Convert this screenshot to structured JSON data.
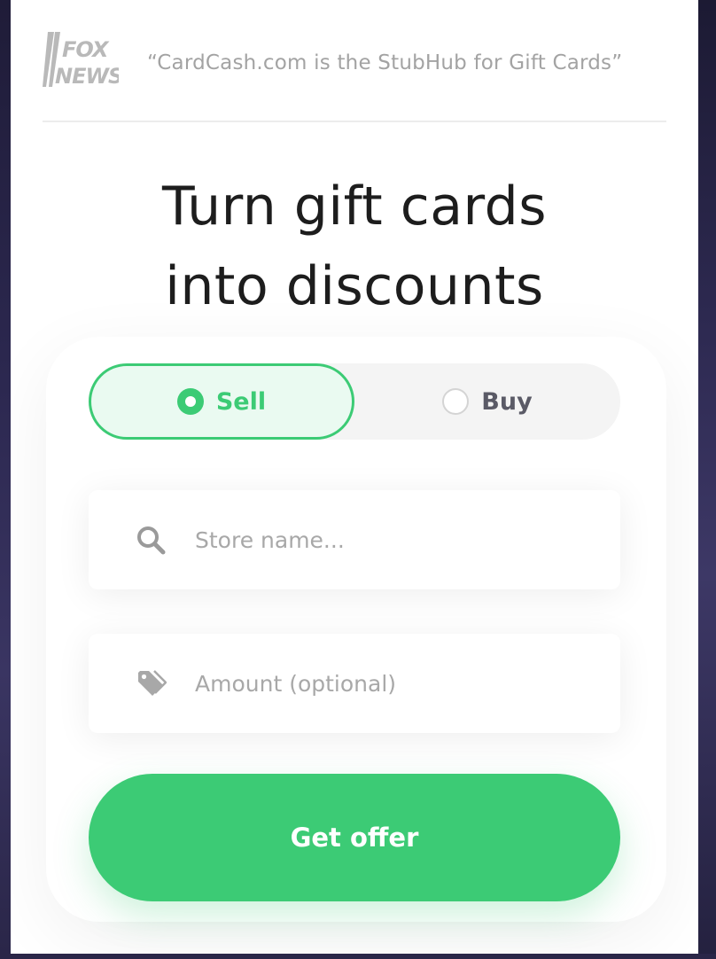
{
  "press": {
    "logo": {
      "icon": "fox-news-logo",
      "text_line1": "FOX",
      "text_line2": "NEWS"
    },
    "quote": "“CardCash.com is the StubHub for Gift Cards”"
  },
  "headline": {
    "line1": "Turn gift cards",
    "line2": "into discounts"
  },
  "mode_toggle": {
    "options": [
      {
        "label": "Sell",
        "selected": true
      },
      {
        "label": "Buy",
        "selected": false
      }
    ]
  },
  "store_field": {
    "icon": "search-icon",
    "placeholder": "Store name...",
    "value": ""
  },
  "amount_field": {
    "icon": "price-tag-icon",
    "placeholder": "Amount (optional)",
    "value": ""
  },
  "cta": {
    "label": "Get offer"
  },
  "colors": {
    "accent": "#3ccb75",
    "accent_tint": "#eafaf1",
    "headline": "#1d1d1d",
    "muted": "#a3a3a3",
    "backdrop": "#24213f"
  }
}
